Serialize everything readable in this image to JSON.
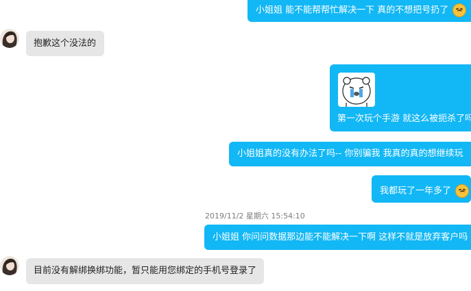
{
  "messages": [
    {
      "text": "小姐姐 能不能帮帮忙解决一下  真的不想把号扔了",
      "emoji": "sad-emoji"
    },
    {
      "text": "抱歉这个没法的"
    },
    {
      "text": "第一次玩个手游 就这么被扼杀了吗",
      "sticker": "crying-bear-sticker"
    },
    {
      "text": "小姐姐真的没有办法了吗--  你别骗我  我真的真的想继续玩"
    },
    {
      "text": "我都玩了一年多了",
      "emoji": "sad-emoji"
    },
    {
      "text": "小姐姐 你问问数据那边能不能解决一下啊  这样不就是放弃客户吗"
    },
    {
      "text": "目前没有解绑换绑功能，暂只能用您绑定的手机号登录了"
    }
  ],
  "timestamp": "2019/11/2 星期六 15:54:10",
  "colors": {
    "outgoing_bubble": "#12b7f5",
    "incoming_bubble": "#e6e6e6",
    "timestamp": "#7b7b7b"
  }
}
